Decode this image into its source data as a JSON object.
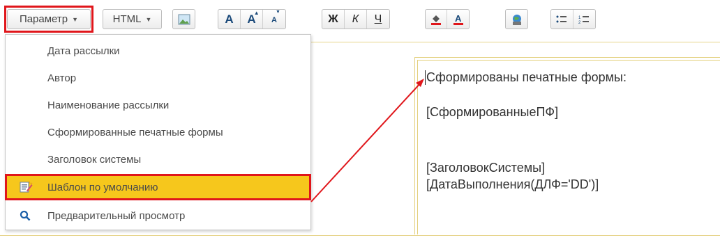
{
  "toolbar": {
    "param_label": "Параметр",
    "html_label": "HTML",
    "font_a": "A",
    "font_a_up": "A",
    "font_a_down": "A",
    "bold": "Ж",
    "italic": "К",
    "underline": "Ч"
  },
  "menu": {
    "items": [
      {
        "label": "Дата рассылки"
      },
      {
        "label": "Автор"
      },
      {
        "label": "Наименование рассылки"
      },
      {
        "label": "Сформированные печатные формы"
      },
      {
        "label": "Заголовок системы"
      },
      {
        "label": "Шаблон по умолчанию",
        "icon": "template-edit-icon"
      },
      {
        "label": "Предварительный просмотр",
        "icon": "search-icon"
      }
    ]
  },
  "editor": {
    "lines": [
      "Сформированы печатные формы:",
      "[СформированныеПФ]",
      "[ЗаголовокСистемы]",
      "[ДатаВыполнения(ДЛФ='DD')]"
    ]
  },
  "colors": {
    "highlight_border": "#e0161b",
    "selected_item": "#f6c71c",
    "editor_border": "#e3cf7b"
  }
}
